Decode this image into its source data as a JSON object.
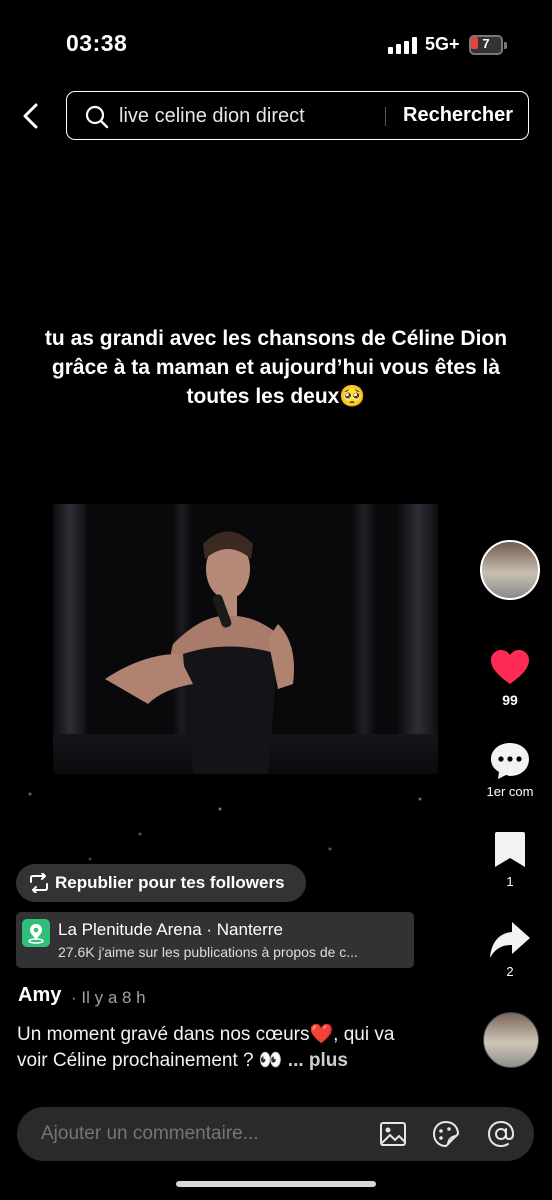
{
  "status": {
    "time": "03:38",
    "network": "5G+",
    "battery": "7"
  },
  "search": {
    "query": "live celine dion direct",
    "button": "Rechercher"
  },
  "caption": "tu as grandi avec les chansons de Céline Dion grâce à ta maman et aujourd’hui vous êtes là toutes les deux🥺",
  "actions": {
    "likes": "99",
    "comments": "1er com",
    "saves": "1",
    "shares": "2"
  },
  "repost": {
    "label": "Republier pour tes followers"
  },
  "location": {
    "title": "La Plenitude Arena · Nanterre",
    "subtitle": "27.6K j'aime sur les publications à propos de c..."
  },
  "post": {
    "author": "Amy",
    "time": "· Il y a 8 h",
    "description": "Un moment gravé dans nos cœurs❤️, qui va voir Céline prochainement ? 👀 ",
    "more": "... plus"
  },
  "comment": {
    "placeholder": "Ajouter un commentaire..."
  },
  "colors": {
    "like": "#fe2c55",
    "background": "#000000",
    "location_icon": "#2fbf7a"
  },
  "icons": [
    "chevron-left-icon",
    "search-icon",
    "heart-icon",
    "comment-icon",
    "bookmark-icon",
    "share-icon",
    "repost-icon",
    "location-pin-icon",
    "image-icon",
    "sticker-icon",
    "at-icon"
  ]
}
